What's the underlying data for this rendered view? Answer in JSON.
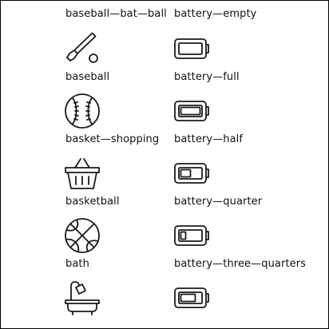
{
  "icons": [
    {
      "label": "baseball—bat—ball",
      "icon": "baseball-bat-ball-icon"
    },
    {
      "label": "battery—empty",
      "icon": "battery-empty-icon"
    },
    {
      "label": "baseball",
      "icon": "baseball-icon"
    },
    {
      "label": "battery—full",
      "icon": "battery-full-icon"
    },
    {
      "label": "basket—shopping",
      "icon": "basket-shopping-icon"
    },
    {
      "label": "battery—half",
      "icon": "battery-half-icon"
    },
    {
      "label": "basketball",
      "icon": "basketball-icon"
    },
    {
      "label": "battery—quarter",
      "icon": "battery-quarter-icon"
    },
    {
      "label": "bath",
      "icon": "bath-icon"
    },
    {
      "label": "battery—three—quarters",
      "icon": "battery-three-quarters-icon"
    }
  ],
  "colors": {
    "stroke": "#1a1a1a",
    "text": "#111111",
    "background": "#ffffff",
    "border": "#000000"
  }
}
